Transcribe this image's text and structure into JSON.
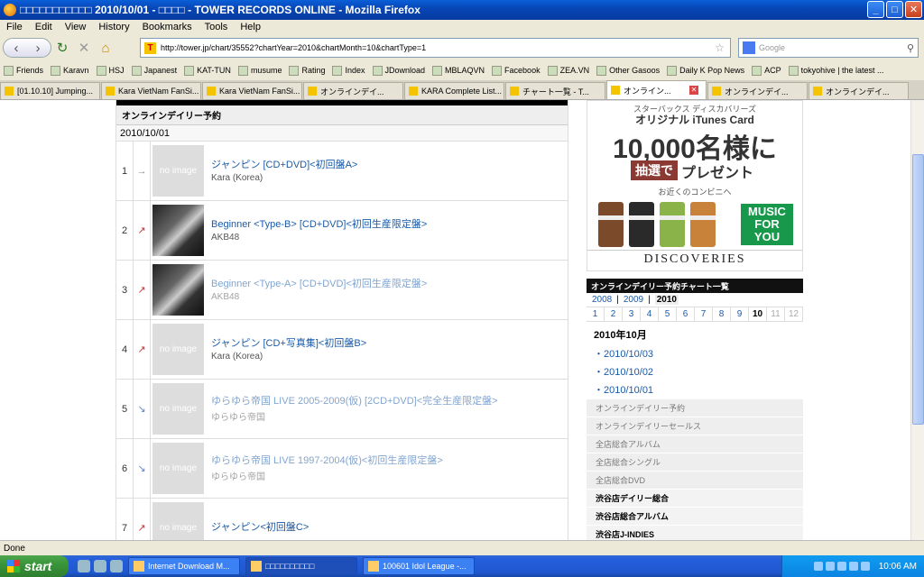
{
  "window": {
    "title": "□□□□□□□□□□□ 2010/10/01 - □□□□ - TOWER RECORDS ONLINE - Mozilla Firefox"
  },
  "menu": [
    "File",
    "Edit",
    "View",
    "History",
    "Bookmarks",
    "Tools",
    "Help"
  ],
  "url": "http://tower.jp/chart/35552?chartYear=2010&chartMonth=10&chartType=1",
  "search_placeholder": "Google",
  "bookmarks": [
    "Friends",
    "Karavn",
    "HSJ",
    "Japanest",
    "KAT-TUN",
    "musume",
    "Rating",
    "Index",
    "JDownload",
    "MBLAQVN",
    "Facebook",
    "ZEA.VN",
    "Other Gasoos",
    "Daily K Pop News",
    "ACP",
    "tokyohive | the latest ..."
  ],
  "tabs": [
    {
      "label": "[01.10.10] Jumping...",
      "active": false
    },
    {
      "label": "Kara VietNam FanSi...",
      "active": false
    },
    {
      "label": "Kara VietNam FanSi...",
      "active": false
    },
    {
      "label": "オンラインデイ...",
      "active": false
    },
    {
      "label": "KARA Complete List...",
      "active": false
    },
    {
      "label": "チャート一覧 - T...",
      "active": false
    },
    {
      "label": "オンライン...",
      "active": true
    },
    {
      "label": "オンラインデイ...",
      "active": false
    },
    {
      "label": "オンラインデイ...",
      "active": false
    }
  ],
  "chart": {
    "heading": "オンラインデイリー予約",
    "date": "2010/10/01",
    "no_image": "no image",
    "rows": [
      {
        "rank": "1",
        "trend": "→",
        "title": "ジャンピン [CD+DVD]<初回盤A>",
        "artist": "Kara (Korea)",
        "img": "none",
        "faded": false
      },
      {
        "rank": "2",
        "trend": "↗",
        "title": "Beginner <Type-B> [CD+DVD]<初回生産限定盤>",
        "artist": "AKB48",
        "img": "photo",
        "faded": false
      },
      {
        "rank": "3",
        "trend": "↗",
        "title": "Beginner <Type-A> [CD+DVD]<初回生産限定盤>",
        "artist": "AKB48",
        "img": "photo",
        "faded": true
      },
      {
        "rank": "4",
        "trend": "↗",
        "title": "ジャンピン [CD+写真集]<初回盤B>",
        "artist": "Kara (Korea)",
        "img": "none",
        "faded": false
      },
      {
        "rank": "5",
        "trend": "↘",
        "title": "ゆらゆら帝国 LIVE 2005-2009(仮) [2CD+DVD]<完全生産限定盤>",
        "artist": "ゆらゆら帝国",
        "img": "none",
        "faded": true
      },
      {
        "rank": "6",
        "trend": "↘",
        "title": "ゆらゆら帝国 LIVE 1997-2004(仮)<初回生産限定盤>",
        "artist": "ゆらゆら帝国",
        "img": "none",
        "faded": true
      },
      {
        "rank": "7",
        "trend": "↗",
        "title": "ジャンピン<初回盤C>",
        "artist": "",
        "img": "none",
        "faded": false
      }
    ]
  },
  "ad": {
    "line1": "スターバックス ディスカバリーズ",
    "line2": "オリジナル iTunes Card",
    "line3": "10,000名様に",
    "line4a": "抽選で",
    "line4b": "プレゼント",
    "line5": "お近くのコンビニへ",
    "music": "MUSIC FOR YOU",
    "brand": "DISCOVERIES",
    "cup_colors": [
      "#7a4a2a",
      "#2a2a2a",
      "#8ab34a",
      "#c8823a"
    ]
  },
  "sidebar": {
    "list_title": "オンラインデイリー予約チャート一覧",
    "years": [
      "2008",
      "2009",
      "2010"
    ],
    "current_year": "2010",
    "months": [
      "1",
      "2",
      "3",
      "4",
      "5",
      "6",
      "7",
      "8",
      "9",
      "10",
      "11",
      "12"
    ],
    "current_month": "10",
    "month_title": "2010年10月",
    "dates": [
      "・2010/10/03",
      "・2010/10/02",
      "・2010/10/01"
    ],
    "categories": [
      {
        "label": "オンラインデイリー予約",
        "dark": false
      },
      {
        "label": "オンラインデイリーセールス",
        "dark": false
      },
      {
        "label": "全店総合アルバム",
        "dark": false
      },
      {
        "label": "全店総合シングル",
        "dark": false
      },
      {
        "label": "全店総合DVD",
        "dark": false
      },
      {
        "label": "渋谷店デイリー総合",
        "dark": true
      },
      {
        "label": "渋谷店総合アルバム",
        "dark": true
      },
      {
        "label": "渋谷店J-INDIES",
        "dark": true
      }
    ]
  },
  "status": "Done",
  "taskbar": {
    "start": "start",
    "tasks": [
      {
        "label": "Internet Download M...",
        "active": false
      },
      {
        "label": "□□□□□□□□□□",
        "active": true
      },
      {
        "label": "100601 Idol League -...",
        "active": false
      }
    ],
    "clock": "10:06 AM"
  }
}
